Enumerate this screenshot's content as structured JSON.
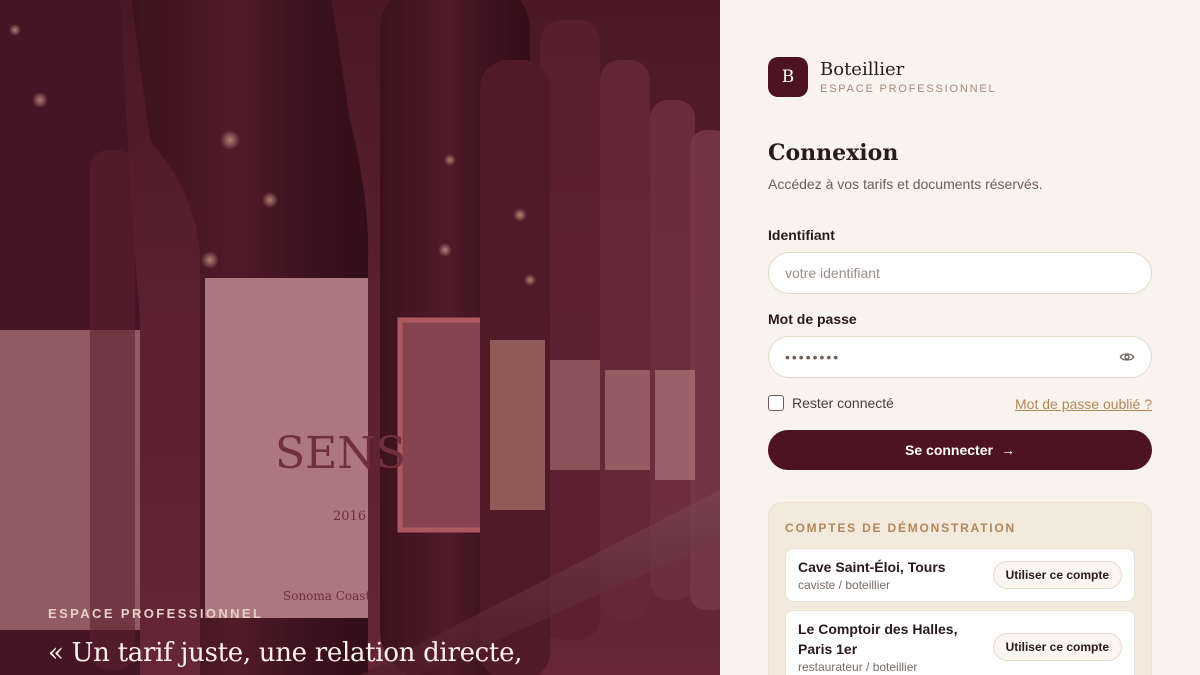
{
  "hero": {
    "eyebrow": "ESPACE PROFESSIONNEL",
    "quote": "« Un tarif juste, une relation directe,",
    "label_text": "SENS",
    "label_vintage": "2016",
    "label_footer": "Sonoma Coast"
  },
  "brand": {
    "logo_letter": "B",
    "name": "Boteillier",
    "subtitle": "ESPACE PROFESSIONNEL"
  },
  "login": {
    "title": "Connexion",
    "subtitle": "Accédez à vos tarifs et documents réservés.",
    "identifier_label": "Identifiant",
    "identifier_placeholder": "votre identifiant",
    "password_label": "Mot de passe",
    "password_value": "••••••••",
    "remember_label": "Rester connecté",
    "forgot_link": "Mot de passe oublié ?",
    "submit_label": "Se connecter",
    "submit_icon": "arrow-right-icon"
  },
  "demo": {
    "title": "COMPTES DE DÉMONSTRATION",
    "accounts": [
      {
        "name": "Cave Saint-Éloi, Tours",
        "role": "caviste / boteillier",
        "button": "Utiliser ce compte"
      },
      {
        "name": "Le Comptoir des Halles, Paris 1er",
        "role": "restaurateur / boteillier",
        "button": "Utiliser ce compte"
      }
    ]
  },
  "colors": {
    "accent": "#4d1320",
    "gold": "#b28758",
    "panel_bg": "#f8f3ec"
  }
}
